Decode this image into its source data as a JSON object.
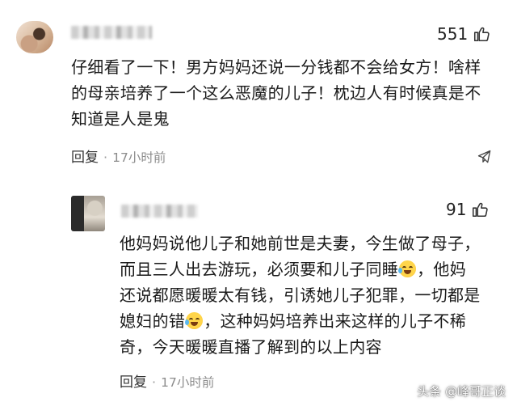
{
  "comments": [
    {
      "likes": "551",
      "lines": [
        "仔细看了一下！男方妈妈还说一分钱都不会给女方！啥样",
        "的母亲培养了一个这么恶魔的儿子！枕边人有时候真是不",
        "知道是人是鬼"
      ],
      "reply_label": "回复",
      "separator": "·",
      "time": "17小时前"
    },
    {
      "likes": "91",
      "lines": [
        "他妈妈说他儿子和她前世是夫妻，今生做了母子，",
        "而且三人出去游玩，必须要和儿子同睡",
        "，他妈",
        "还说都愿暖暖太有钱，引诱她儿子犯罪，一切都是",
        "媳妇的错",
        "，这种妈妈培养出来这样的儿子不稀",
        "奇，今天暖暖直播了解到的以上内容"
      ],
      "reply_label": "回复",
      "separator": "·",
      "time": "17小时前"
    }
  ],
  "watermark": "头条 @峰哥正谈",
  "icons": {
    "like": "thumbs-up-icon",
    "share": "share-icon",
    "emoji": "laughing-crying-emoji-icon"
  }
}
